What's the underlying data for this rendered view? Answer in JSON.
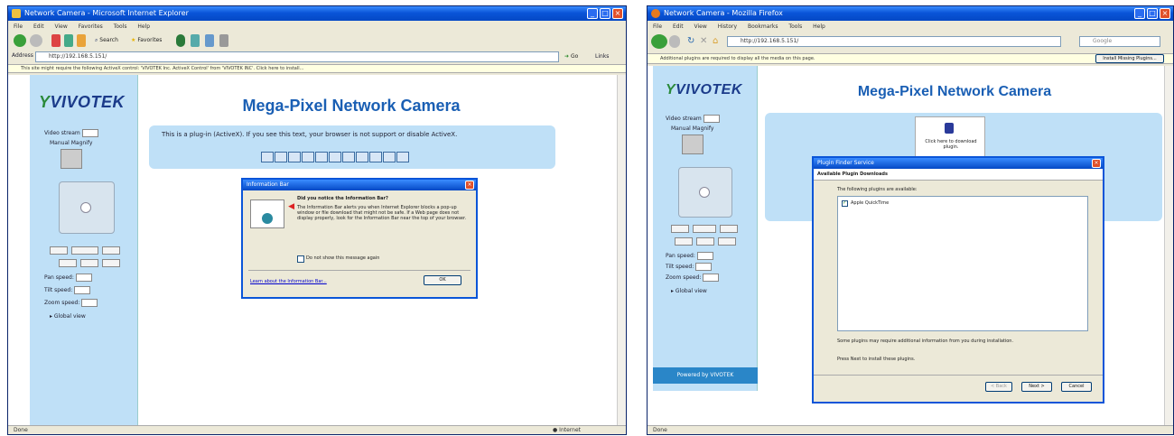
{
  "left": {
    "title": "Network Camera - Microsoft Internet Explorer",
    "menu": [
      "File",
      "Edit",
      "View",
      "Favorites",
      "Tools",
      "Help"
    ],
    "toolbar": {
      "search": "Search",
      "favorites": "Favorites"
    },
    "address": {
      "label": "Address",
      "value": "http://192.168.5.151/"
    },
    "go": "Go",
    "links": "Links",
    "infobar": "This site might require the following ActiveX control: 'VIVOTEK Inc. ActiveX Control' from 'VIVOTEK INC'. Click here to install...",
    "logo": "VIVOTEK",
    "page_title": "Mega-Pixel Network Camera",
    "sidebar": {
      "video_stream": "Video stream",
      "stream_value": "1",
      "manual_magnify": "Manual Magnify",
      "zoom_out": "Zoom out",
      "focus": "Focus",
      "zoom_in": "Zoom in",
      "pan_speed": "Pan speed:",
      "tilt_speed": "Tilt speed:",
      "zoom_speed": "Zoom speed:",
      "speed_value": "1",
      "global_view": "Global view"
    },
    "plugin_message": "This is a plug-in (ActiveX). If you see this text, your browser is not support or disable ActiveX.",
    "dialog": {
      "title": "Information Bar",
      "question": "Did you notice the Information Bar?",
      "body": "The Information Bar alerts you when Internet Explorer blocks a pop-up window or file download that might not be safe. If a Web page does not display properly, look for the Information Bar near the top of your browser.",
      "checkbox": "Do not show this message again",
      "link": "Learn about the Information Bar...",
      "ok": "OK"
    },
    "status": "Done",
    "zone": "Internet"
  },
  "right": {
    "title": "Network Camera - Mozilla Firefox",
    "menu": [
      "File",
      "Edit",
      "View",
      "History",
      "Bookmarks",
      "Tools",
      "Help"
    ],
    "address": "http://192.168.5.151/",
    "search_placeholder": "Google",
    "infobar": "Additional plugins are required to display all the media on this page.",
    "install_button": "Install Missing Plugins...",
    "logo": "VIVOTEK",
    "page_title": "Mega-Pixel Network Camera",
    "plugin_download": "Click here to download plugin.",
    "sidebar": {
      "video_stream": "Video stream",
      "stream_value": "1",
      "manual_magnify": "Manual Magnify",
      "zoom_out": "Zoom out",
      "focus": "Focus",
      "zoom_in": "Zoom in",
      "pan_speed": "Pan speed:",
      "tilt_speed": "Tilt speed:",
      "zoom_speed": "Zoom speed:",
      "speed_value": "1",
      "global_view": "Global view",
      "powered_by": "Powered by VIVOTEK"
    },
    "dialog": {
      "title": "Plugin Finder Service",
      "subtitle": "Available Plugin Downloads",
      "intro": "The following plugins are available:",
      "plugin_item": "Apple QuickTime",
      "note": "Some plugins may require additional information from you during installation.",
      "instruction": "Press Next to install these plugins.",
      "back": "< Back",
      "next": "Next >",
      "cancel": "Cancel"
    },
    "status": "Done"
  }
}
